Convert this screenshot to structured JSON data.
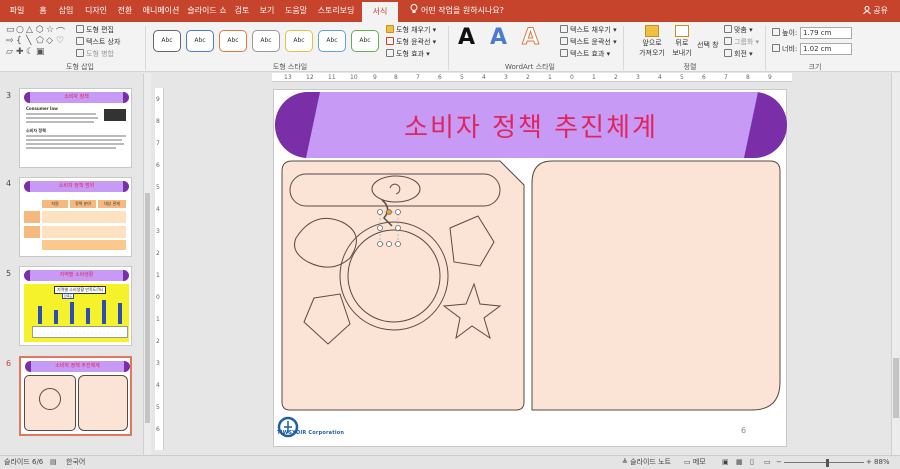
{
  "ribbon_tabs": [
    "파일",
    "홈",
    "삽입",
    "디자인",
    "전환",
    "애니메이션",
    "슬라이드 쇼",
    "검토",
    "보기",
    "도움말",
    "스토리보딩",
    "서식"
  ],
  "active_tab": "서식",
  "tell_me": "어떤 작업을 원하시나요?",
  "share": "공유",
  "groups": {
    "insert_shapes": {
      "label": "도형 삽입",
      "edit_shape": "도형 편집",
      "text_box": "텍스트 상자",
      "merge_shapes": "도형 병합"
    },
    "shape_styles": {
      "label": "도형 스타일",
      "swatch_text": "Abc",
      "fill": "도형 채우기",
      "outline": "도형 윤곽선",
      "effects": "도형 효과"
    },
    "wordart": {
      "label": "WordArt 스타일",
      "letter": "A",
      "text_fill": "텍스트 채우기",
      "text_outline": "텍스트 윤곽선",
      "text_effects": "텍스트 효과"
    },
    "arrange": {
      "label": "정렬",
      "bring_forward_1": "앞으로",
      "bring_forward_2": "가져오기",
      "send_backward_1": "뒤로",
      "send_backward_2": "보내기",
      "selection_pane_1": "선택 창",
      "align": "맞춤",
      "group": "그룹화",
      "rotate": "회전"
    },
    "size": {
      "label": "크기",
      "height_label": "높이:",
      "height_value": "1.79 cm",
      "width_label": "너비:",
      "width_value": "1.02 cm"
    }
  },
  "thumbnails": [
    {
      "num": "3",
      "title": "소비자 정책",
      "heading1": "Consumer law",
      "heading2": "소비자 정책"
    },
    {
      "num": "4",
      "title": "소비자 정책 범위",
      "cells": [
        "지원",
        "정책 분야",
        "대상 관계"
      ]
    },
    {
      "num": "5",
      "title": "지역별 소비생활",
      "chart_title": "지역별 소비생활 만족도(%)",
      "legend": "만족도"
    },
    {
      "num": "6",
      "title": "소비자 정책 추진체계"
    }
  ],
  "active_slide": "6",
  "slide": {
    "title": "소비자 정책 추진체계",
    "page_number": "6",
    "logo_text": "TIWSYDIR Corporation"
  },
  "status": {
    "slide_info": "슬라이드 6/6",
    "language": "한국어",
    "notes": "슬라이드 노트",
    "comments": "메모",
    "zoom": "88%"
  },
  "colors": {
    "accent": "#c6442c",
    "banner_fill": "#c79bf5",
    "banner_end": "#7a2fa8",
    "title_text": "#e0245e",
    "panel_fill": "#fbe3d6",
    "outline": "#5a4a42"
  }
}
